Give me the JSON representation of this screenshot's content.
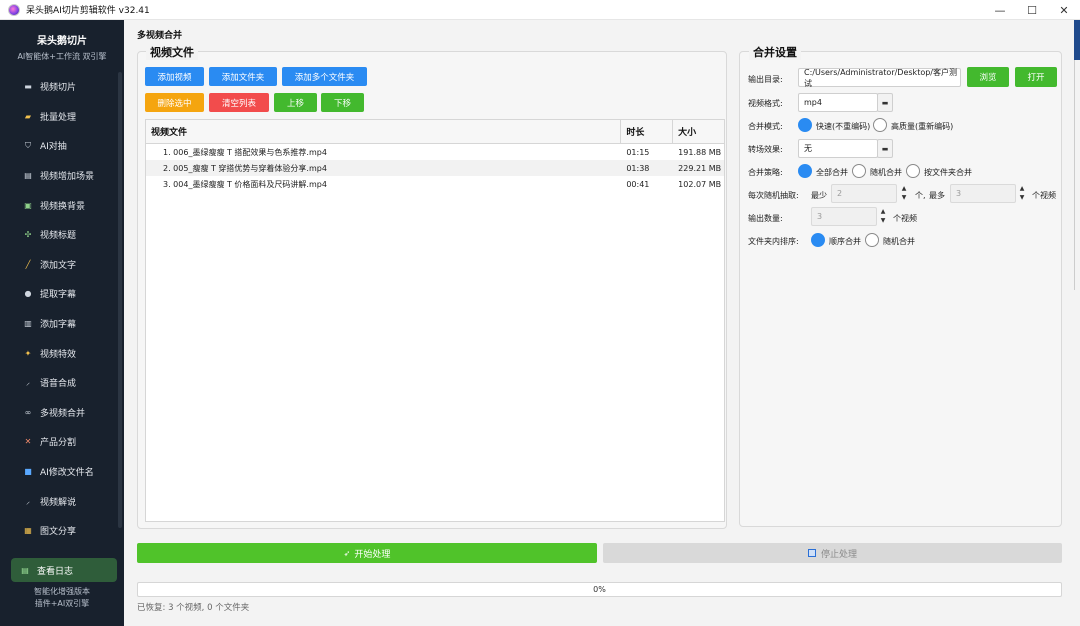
{
  "window": {
    "title": "呆头鹅AI切片剪辑软件 v32.41",
    "controls": [
      "—",
      "☐",
      "✕"
    ]
  },
  "sidebar": {
    "brand_name": "呆头鹅切片",
    "brand_sub": "AI智能体+工作流 双引擎",
    "items": [
      {
        "label": "视频切片",
        "icon": "film-icon"
      },
      {
        "label": "批量处理",
        "icon": "folder-icon"
      },
      {
        "label": "AI对抽",
        "icon": "shield-icon"
      },
      {
        "label": "视频增加场景",
        "icon": "scene-icon"
      },
      {
        "label": "视频换背景",
        "icon": "image-icon"
      },
      {
        "label": "视频标题",
        "icon": "sparkle-icon"
      },
      {
        "label": "添加文字",
        "icon": "pen-icon"
      },
      {
        "label": "提取字幕",
        "icon": "mic-icon"
      },
      {
        "label": "添加字幕",
        "icon": "doc-icon"
      },
      {
        "label": "视频特效",
        "icon": "star-icon"
      },
      {
        "label": "语音合成",
        "icon": "mic-pen-icon"
      },
      {
        "label": "多视频合并",
        "icon": "link-icon"
      },
      {
        "label": "产品分割",
        "icon": "scissors-icon"
      },
      {
        "label": "AI修改文件名",
        "icon": "rename-icon"
      },
      {
        "label": "视频解说",
        "icon": "speech-icon"
      },
      {
        "label": "图文分享",
        "icon": "gallery-icon"
      }
    ],
    "log_button": "查看日志",
    "footer_line1": "智能化增强版本",
    "footer_line2": "插件+AI双引擎"
  },
  "main": {
    "page_title": "多视频合并",
    "files_panel": {
      "title": "视频文件",
      "buttons": {
        "add_video": "添加视频",
        "add_folder": "添加文件夹",
        "add_multi_folder": "添加多个文件夹",
        "remove_selected": "删除选中",
        "clear_list": "清空列表",
        "move_up": "上移",
        "move_down": "下移"
      },
      "columns": [
        "视频文件",
        "时长",
        "大小"
      ],
      "rows": [
        {
          "name": "1. 006_墨绿瘦瘦 T 搭配效果与色系推荐.mp4",
          "duration": "01:15",
          "size": "191.88 MB"
        },
        {
          "name": "2. 005_瘦瘦 T 穿搭优势与穿着体验分享.mp4",
          "duration": "01:38",
          "size": "229.21 MB"
        },
        {
          "name": "3. 004_墨绿瘦瘦 T 价格面料及尺码讲解.mp4",
          "duration": "00:41",
          "size": "102.07 MB"
        }
      ]
    },
    "settings_panel": {
      "title": "合并设置",
      "output_dir_label": "输出目录:",
      "output_dir_value": "C:/Users/Administrator/Desktop/客户测试",
      "browse": "浏览",
      "open": "打开",
      "format_label": "视频格式:",
      "format_value": "mp4",
      "merge_mode_label": "合并模式:",
      "merge_mode_fast": "快速(不重编码)",
      "merge_mode_hq": "高质量(重新编码)",
      "transition_label": "转场效果:",
      "transition_value": "无",
      "strategy_label": "合并策略:",
      "strategy_all": "全部合并",
      "strategy_random": "随机合并",
      "strategy_folder": "按文件夹合并",
      "random_pick_label": "每次随机抽取:",
      "min_label": "最少",
      "min_value": "2",
      "unit_ge": "个,",
      "max_label": "最多",
      "max_value": "3",
      "unit_videos": "个视频",
      "output_count_label": "输出数量:",
      "output_count_value": "3",
      "unit_output": "个视频",
      "sort_label": "文件夹内排序:",
      "sort_seq": "顺序合并",
      "sort_random": "随机合并"
    },
    "start_button": "开始处理",
    "stop_button": "停止处理",
    "progress": 0,
    "progress_text": "0%",
    "status_text": "已恢复: 3 个视频, 0 个文件夹"
  },
  "colors": {
    "sidebar_bg": "#18212d",
    "accent_blue": "#2a8bf2",
    "accent_green": "#43b92e",
    "start_green": "#50c32a",
    "danger_red": "#f24c4c",
    "warn_orange": "#f5a50f"
  }
}
